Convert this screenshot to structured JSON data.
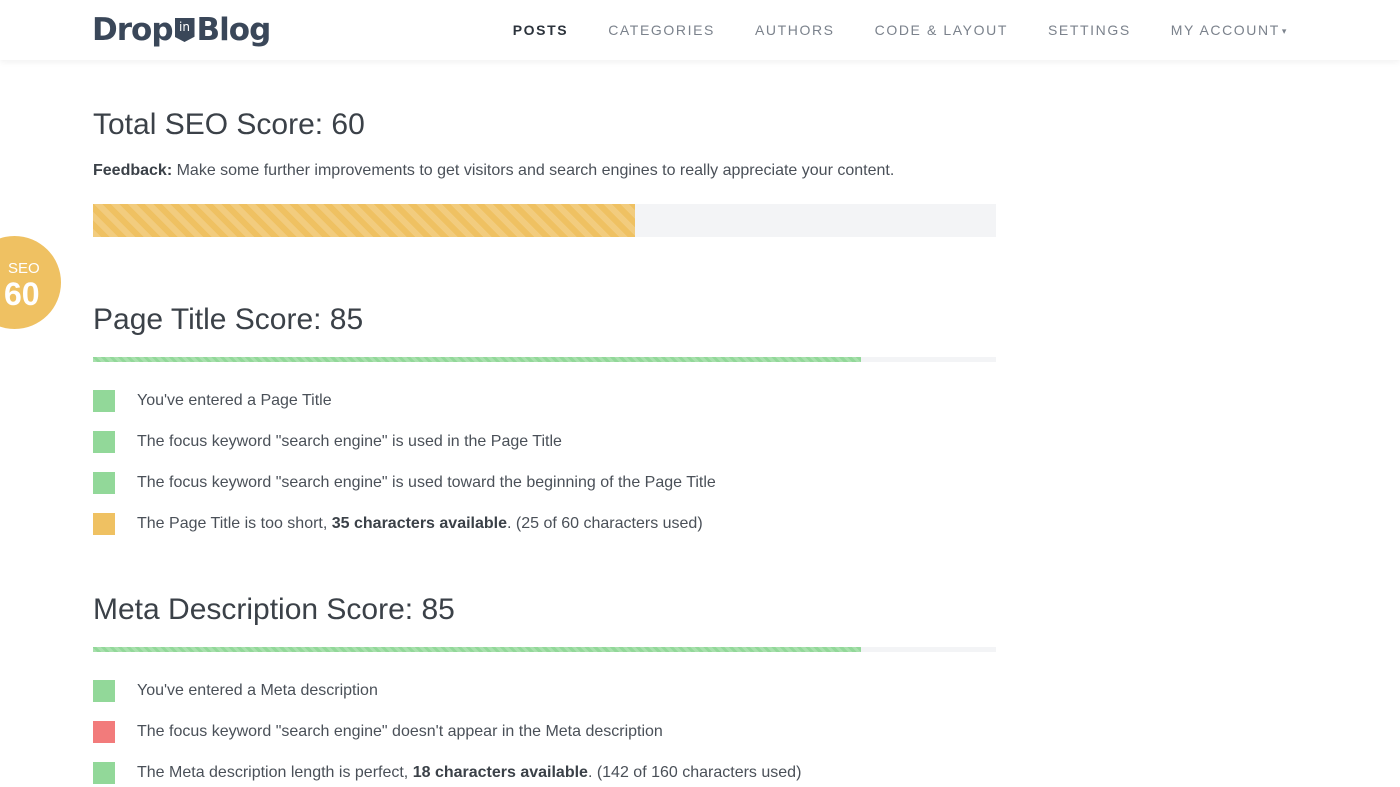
{
  "brand": {
    "part1": "Drop",
    "badge": "in",
    "part2": "Blog"
  },
  "nav": [
    {
      "label": "POSTS",
      "active": true
    },
    {
      "label": "CATEGORIES",
      "active": false
    },
    {
      "label": "AUTHORS",
      "active": false
    },
    {
      "label": "CODE & LAYOUT",
      "active": false
    },
    {
      "label": "SETTINGS",
      "active": false
    },
    {
      "label": "MY ACCOUNT",
      "active": false,
      "caret": "▾"
    }
  ],
  "seo_badge": {
    "label": "SEO",
    "value": "60"
  },
  "total": {
    "heading": "Total SEO Score: 60",
    "score": 60,
    "feedback_label": "Feedback:",
    "feedback_text": " Make some further improvements to get visitors and search engines to really appreciate your content."
  },
  "page_title": {
    "heading": "Page Title Score: 85",
    "score": 85,
    "checks": [
      {
        "status": "pass",
        "pre": "You've entered a Page Title",
        "bold": "",
        "post": ""
      },
      {
        "status": "pass",
        "pre": "The focus keyword \"search engine\" is used in the Page Title",
        "bold": "",
        "post": ""
      },
      {
        "status": "pass",
        "pre": "The focus keyword \"search engine\" is used toward the beginning of the Page Title",
        "bold": "",
        "post": ""
      },
      {
        "status": "warn",
        "pre": "The Page Title is too short, ",
        "bold": "35 characters available",
        "post": ". (25 of 60 characters used)"
      }
    ]
  },
  "meta": {
    "heading": "Meta Description Score: 85",
    "score": 85,
    "checks": [
      {
        "status": "pass",
        "pre": "You've entered a Meta description",
        "bold": "",
        "post": ""
      },
      {
        "status": "fail",
        "pre": "The focus keyword \"search engine\" doesn't appear in the Meta description",
        "bold": "",
        "post": ""
      },
      {
        "status": "pass",
        "pre": "The Meta description length is perfect, ",
        "bold": "18 characters available",
        "post": ". (142 of 160 characters used)"
      }
    ]
  },
  "colors": {
    "pass": "#92d899",
    "warn": "#efc162",
    "fail": "#f27b7b",
    "accent": "#efc162"
  }
}
